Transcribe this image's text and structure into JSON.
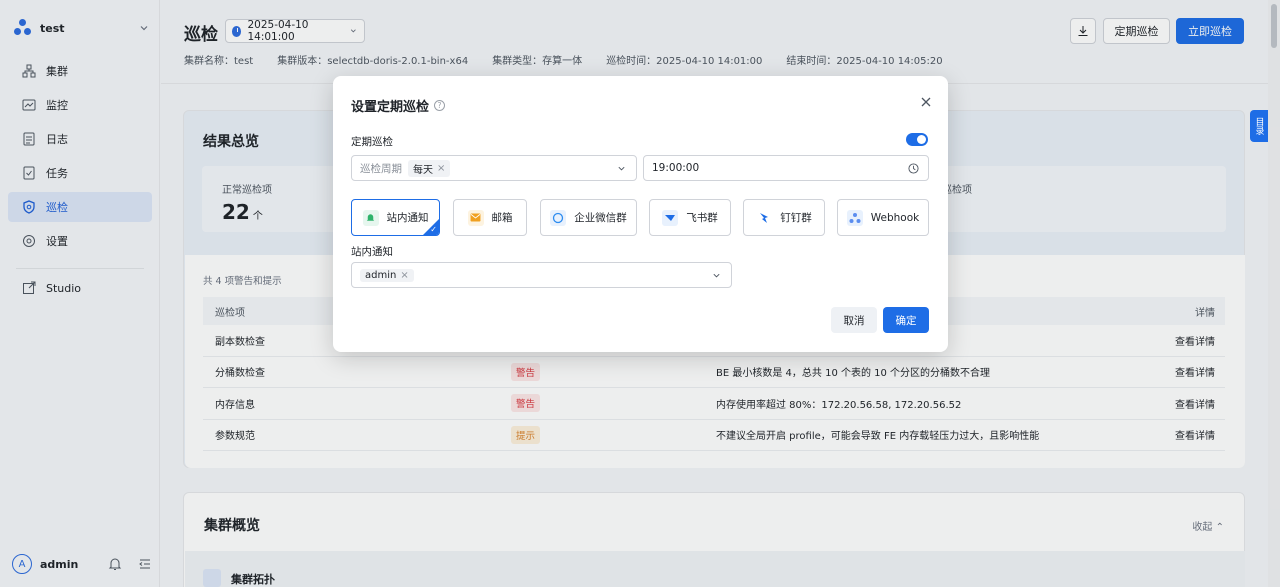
{
  "sidebar": {
    "cluster_name": "test",
    "nav": [
      {
        "label": "集群",
        "icon": "cluster-icon"
      },
      {
        "label": "监控",
        "icon": "monitor-icon"
      },
      {
        "label": "日志",
        "icon": "log-icon"
      },
      {
        "label": "任务",
        "icon": "task-icon"
      },
      {
        "label": "巡检",
        "icon": "inspection-icon",
        "active": true
      },
      {
        "label": "设置",
        "icon": "settings-icon"
      }
    ],
    "studio_label": "Studio",
    "user": {
      "avatar_letter": "A",
      "name": "admin"
    }
  },
  "header": {
    "title": "巡检",
    "time_select": "2025-04-10 14:01:00",
    "meta": {
      "cluster_name": "集群名称：test",
      "cluster_version": "集群版本：selectdb-doris-2.0.1-bin-x64",
      "cluster_type": "集群类型：存算一体",
      "inspect_time": "巡检时间：2025-04-10 14:01:00",
      "end_time": "结束时间：2025-04-10 14:05:20"
    },
    "scheduled_btn": "定期巡检",
    "now_btn": "立即巡检"
  },
  "toc_label": "目录",
  "results": {
    "title": "结果总览",
    "normal_label": "正常巡检项",
    "normal_value": "22",
    "normal_unit": "个",
    "right_label": "巡检项",
    "caption": "共 4 项警告和提示",
    "columns": {
      "item": "巡检项",
      "detail": "详情"
    },
    "rows": [
      {
        "item": "副本数检查",
        "level": "",
        "desc": "",
        "action": "查看详情"
      },
      {
        "item": "分桶数检查",
        "level": "警告",
        "level_type": "warn",
        "desc": "BE 最小核数是 4，总共 10 个表的 10 个分区的分桶数不合理",
        "action": "查看详情"
      },
      {
        "item": "内存信息",
        "level": "警告",
        "level_type": "warn",
        "desc": "内存使用率超过 80%：172.20.56.58, 172.20.56.52",
        "action": "查看详情"
      },
      {
        "item": "参数规范",
        "level": "提示",
        "level_type": "tip",
        "desc": "不建议全局开启 profile，可能会导致 FE 内存载轻压力过大，且影响性能",
        "action": "查看详情"
      }
    ]
  },
  "overview": {
    "title": "集群概览",
    "collapse": "收起",
    "topology": "集群拓扑"
  },
  "modal": {
    "title": "设置定期巡检",
    "schedule_label": "定期巡检",
    "toggle_on": true,
    "period_prefix": "巡检周期",
    "period_tag": "每天",
    "time_value": "19:00:00",
    "channels": [
      {
        "label": "站内通知",
        "icon": "bell-icon",
        "color": "#2fb36b",
        "selected": true
      },
      {
        "label": "邮箱",
        "icon": "mail-icon",
        "color": "#f0a020"
      },
      {
        "label": "企业微信群",
        "icon": "wecom-icon",
        "color": "#2d8cf0"
      },
      {
        "label": "飞书群",
        "icon": "feishu-icon",
        "color": "#1e6de6"
      },
      {
        "label": "钉钉群",
        "icon": "dingtalk-icon",
        "color": "#1e6de6"
      },
      {
        "label": "Webhook",
        "icon": "webhook-icon",
        "color": "#5b8def"
      }
    ],
    "notify_label": "站内通知",
    "notify_tag": "admin",
    "cancel": "取消",
    "confirm": "确定"
  }
}
